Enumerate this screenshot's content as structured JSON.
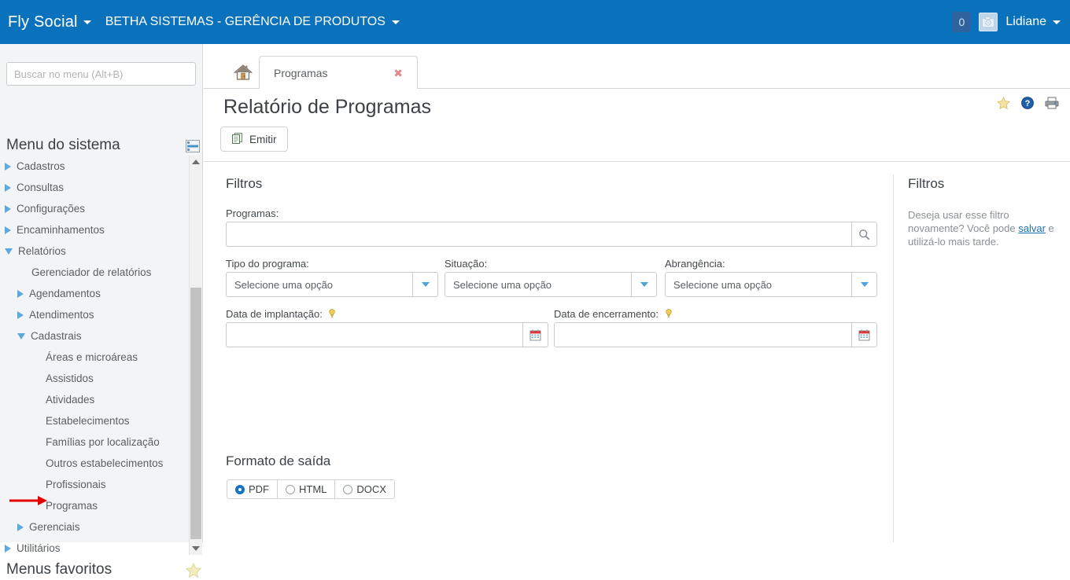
{
  "header": {
    "brand": "Fly Social",
    "organization": "BETHA SISTEMAS - GERÊNCIA DE PRODUTOS",
    "notification_count": "0",
    "username": "Lidiane",
    "brand_caret_icon": "chevron-down-icon",
    "org_caret_icon": "chevron-down-icon",
    "avatar_icon": "avatar-camera-icon",
    "bg_color": "#0a72bd"
  },
  "sidebar": {
    "search_placeholder": "Buscar no menu (Alt+B)",
    "search_value": "",
    "menu_title": "Menu do sistema",
    "panel_toggle_icon": "panel-list-icon",
    "favorites_title": "Menus favoritos",
    "favorites_icon": "star-icon",
    "scroll_up_icon": "triangle-up-icon",
    "scroll_down_icon": "triangle-down-icon",
    "items": [
      {
        "label": "Cadastros",
        "level": 0,
        "state": "closed"
      },
      {
        "label": "Consultas",
        "level": 0,
        "state": "closed"
      },
      {
        "label": "Configurações",
        "level": 0,
        "state": "closed"
      },
      {
        "label": "Encaminhamentos",
        "level": 0,
        "state": "closed"
      },
      {
        "label": "Relatórios",
        "level": 0,
        "state": "open"
      },
      {
        "label": "Gerenciador de relatórios",
        "level": 2,
        "state": "leaf"
      },
      {
        "label": "Agendamentos",
        "level": 1,
        "state": "closed"
      },
      {
        "label": "Atendimentos",
        "level": 1,
        "state": "closed"
      },
      {
        "label": "Cadastrais",
        "level": 1,
        "state": "open"
      },
      {
        "label": "Áreas e microáreas",
        "level": 3,
        "state": "leaf"
      },
      {
        "label": "Assistidos",
        "level": 3,
        "state": "leaf"
      },
      {
        "label": "Atividades",
        "level": 3,
        "state": "leaf"
      },
      {
        "label": "Estabelecimentos",
        "level": 3,
        "state": "leaf"
      },
      {
        "label": "Famílias por localização",
        "level": 3,
        "state": "leaf"
      },
      {
        "label": "Outros estabelecimentos",
        "level": 3,
        "state": "leaf"
      },
      {
        "label": "Profissionais",
        "level": 3,
        "state": "leaf"
      },
      {
        "label": "Programas",
        "level": 3,
        "state": "leaf"
      },
      {
        "label": "Gerenciais",
        "level": 1,
        "state": "closed"
      },
      {
        "label": "Utilitários",
        "level": 0,
        "state": "closed"
      }
    ],
    "annotation": {
      "type": "red-arrow",
      "points_at": "Programas",
      "color": "#e60000"
    }
  },
  "tabs": {
    "home_icon": "home-icon",
    "items": [
      {
        "label": "Programas",
        "active": true,
        "close_icon": "close-icon"
      }
    ]
  },
  "page": {
    "title": "Relatório de Programas",
    "icons": [
      {
        "name": "favorite-star-icon"
      },
      {
        "name": "help-icon"
      },
      {
        "name": "print-icon"
      }
    ],
    "emit_button": {
      "label": "Emitir",
      "icon": "report-copy-icon"
    }
  },
  "filters": {
    "heading": "Filtros",
    "programas": {
      "label": "Programas:",
      "value": "",
      "placeholder": "",
      "search_icon": "magnifier-icon"
    },
    "tipo_programa": {
      "label": "Tipo do programa:",
      "value": "Selecione uma opção",
      "arrow_icon": "chevron-down-icon"
    },
    "situacao": {
      "label": "Situação:",
      "value": "Selecione uma opção",
      "arrow_icon": "chevron-down-icon"
    },
    "abrangencia": {
      "label": "Abrangência:",
      "value": "Selecione uma opção",
      "arrow_icon": "chevron-down-icon"
    },
    "data_implantacao": {
      "label": "Data de implantação:",
      "value": "",
      "hint_icon": "hint-bulb-icon",
      "calendar_icon": "calendar-icon"
    },
    "data_encerramento": {
      "label": "Data de encerramento:",
      "value": "",
      "hint_icon": "hint-bulb-icon",
      "calendar_icon": "calendar-icon"
    }
  },
  "output_format": {
    "heading": "Formato de saída",
    "options": [
      {
        "label": "PDF",
        "selected": true
      },
      {
        "label": "HTML",
        "selected": false
      },
      {
        "label": "DOCX",
        "selected": false
      }
    ]
  },
  "right_panel": {
    "heading": "Filtros",
    "text_before": "Deseja usar esse filtro novamente? Você pode ",
    "link": "salvar",
    "text_after": " e utilizá-lo mais tarde."
  }
}
